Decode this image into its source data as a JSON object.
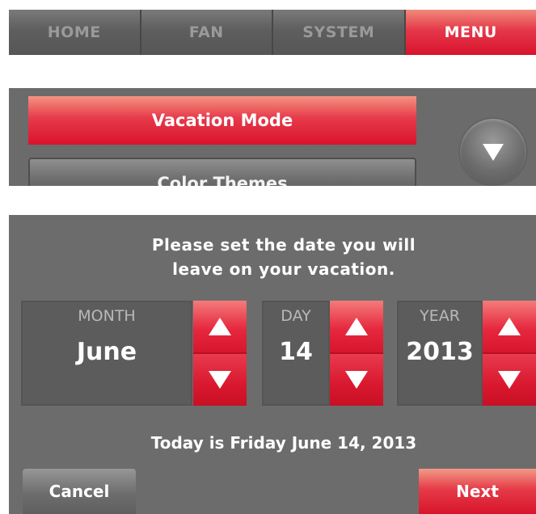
{
  "tabs": [
    {
      "label": "HOME"
    },
    {
      "label": "FAN"
    },
    {
      "label": "SYSTEM"
    },
    {
      "label": "MENU"
    }
  ],
  "active_tab": "MENU",
  "menu": {
    "items": [
      {
        "label": "Vacation Mode",
        "selected": true
      },
      {
        "label": "Color Themes",
        "selected": false
      }
    ],
    "scroll_icon": "chevron-down-icon"
  },
  "date_setup": {
    "prompt_line1": "Please set the date you will",
    "prompt_line2": "leave on your vacation.",
    "month": {
      "label": "MONTH",
      "value": "June"
    },
    "day": {
      "label": "DAY",
      "value": "14"
    },
    "year": {
      "label": "YEAR",
      "value": "2013"
    },
    "today_text": "Today is Friday June 14, 2013",
    "cancel_label": "Cancel",
    "next_label": "Next"
  },
  "icons": {
    "up": "arrow-up-icon",
    "down": "arrow-down-icon"
  },
  "colors": {
    "accent": "#e0243a",
    "panel": "#6c6c6c",
    "tab_inactive_text": "#9a9a9a"
  }
}
